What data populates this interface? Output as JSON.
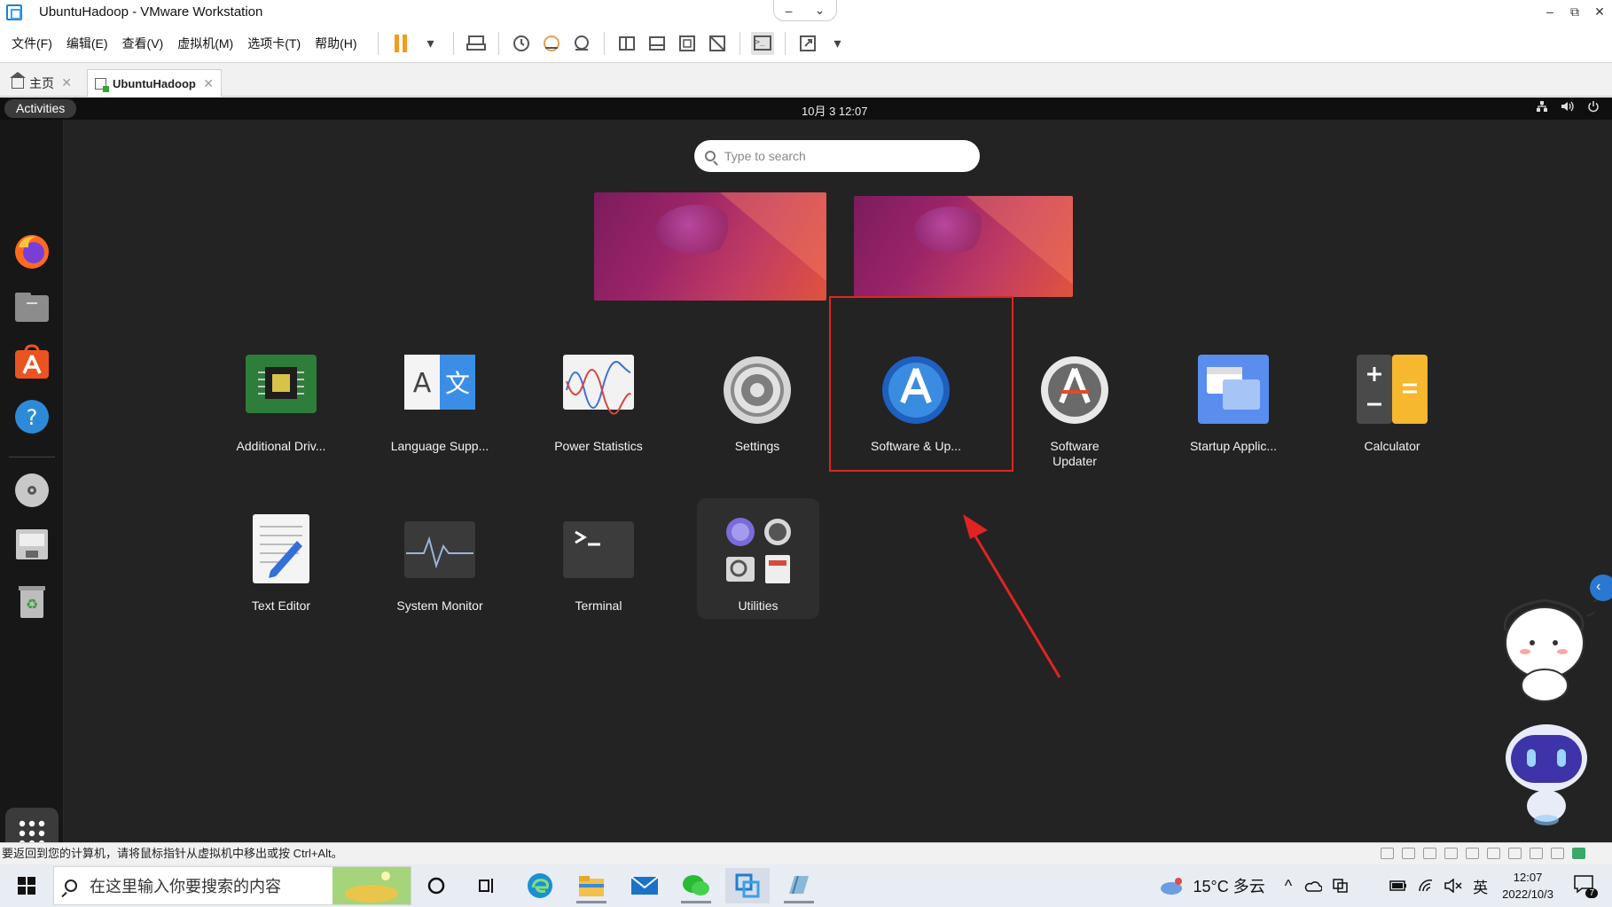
{
  "window": {
    "title": "UbuntuHadoop - VMware Workstation",
    "controls": [
      "–",
      "⧉",
      "✕"
    ],
    "pin_glyphs": [
      "–",
      "⌄"
    ]
  },
  "menu": [
    "文件(F)",
    "编辑(E)",
    "查看(V)",
    "虚拟机(M)",
    "选项卡(T)",
    "帮助(H)"
  ],
  "tabs": [
    {
      "label": "主页"
    },
    {
      "label": "UbuntuHadoop"
    }
  ],
  "guest": {
    "activities": "Activities",
    "clock": "10月 3  12:07",
    "search_placeholder": "Type to search",
    "apps_row1": [
      {
        "label": "Additional Driv...",
        "icon": "chip-icon"
      },
      {
        "label": "Language Supp...",
        "icon": "language-icon"
      },
      {
        "label": "Power Statistics",
        "icon": "chart-icon"
      },
      {
        "label": "Settings",
        "icon": "gear-icon"
      },
      {
        "label": "Software & Up...",
        "icon": "software-properties-icon"
      },
      {
        "label": "Software\nUpdater",
        "icon": "software-updater-icon"
      },
      {
        "label": "Startup Applic...",
        "icon": "startup-icon"
      },
      {
        "label": "Calculator",
        "icon": "calculator-icon"
      }
    ],
    "apps_row2": [
      {
        "label": "Text Editor",
        "icon": "text-editor-icon"
      },
      {
        "label": "System Monitor",
        "icon": "system-monitor-icon"
      },
      {
        "label": "Terminal",
        "icon": "terminal-icon"
      },
      {
        "label": "Utilities",
        "icon": "folder-icon"
      }
    ],
    "dock": [
      "firefox-icon",
      "files-icon",
      "app-center-icon",
      "help-icon",
      "disc-icon",
      "drive-icon",
      "trash-icon"
    ]
  },
  "status": {
    "hint": "要返回到您的计算机，请将鼠标指针从虚拟机中移出或按 Ctrl+Alt。"
  },
  "taskbar": {
    "search_placeholder": "在这里输入你要搜索的内容",
    "weather": "15°C 多云",
    "lang": "英",
    "time": "12:07",
    "date": "2022/10/3",
    "notifications": "7"
  },
  "colors": {
    "guest_bg": "#232323",
    "highlight": "#e02424",
    "accent_orange": "#f29b1c"
  }
}
